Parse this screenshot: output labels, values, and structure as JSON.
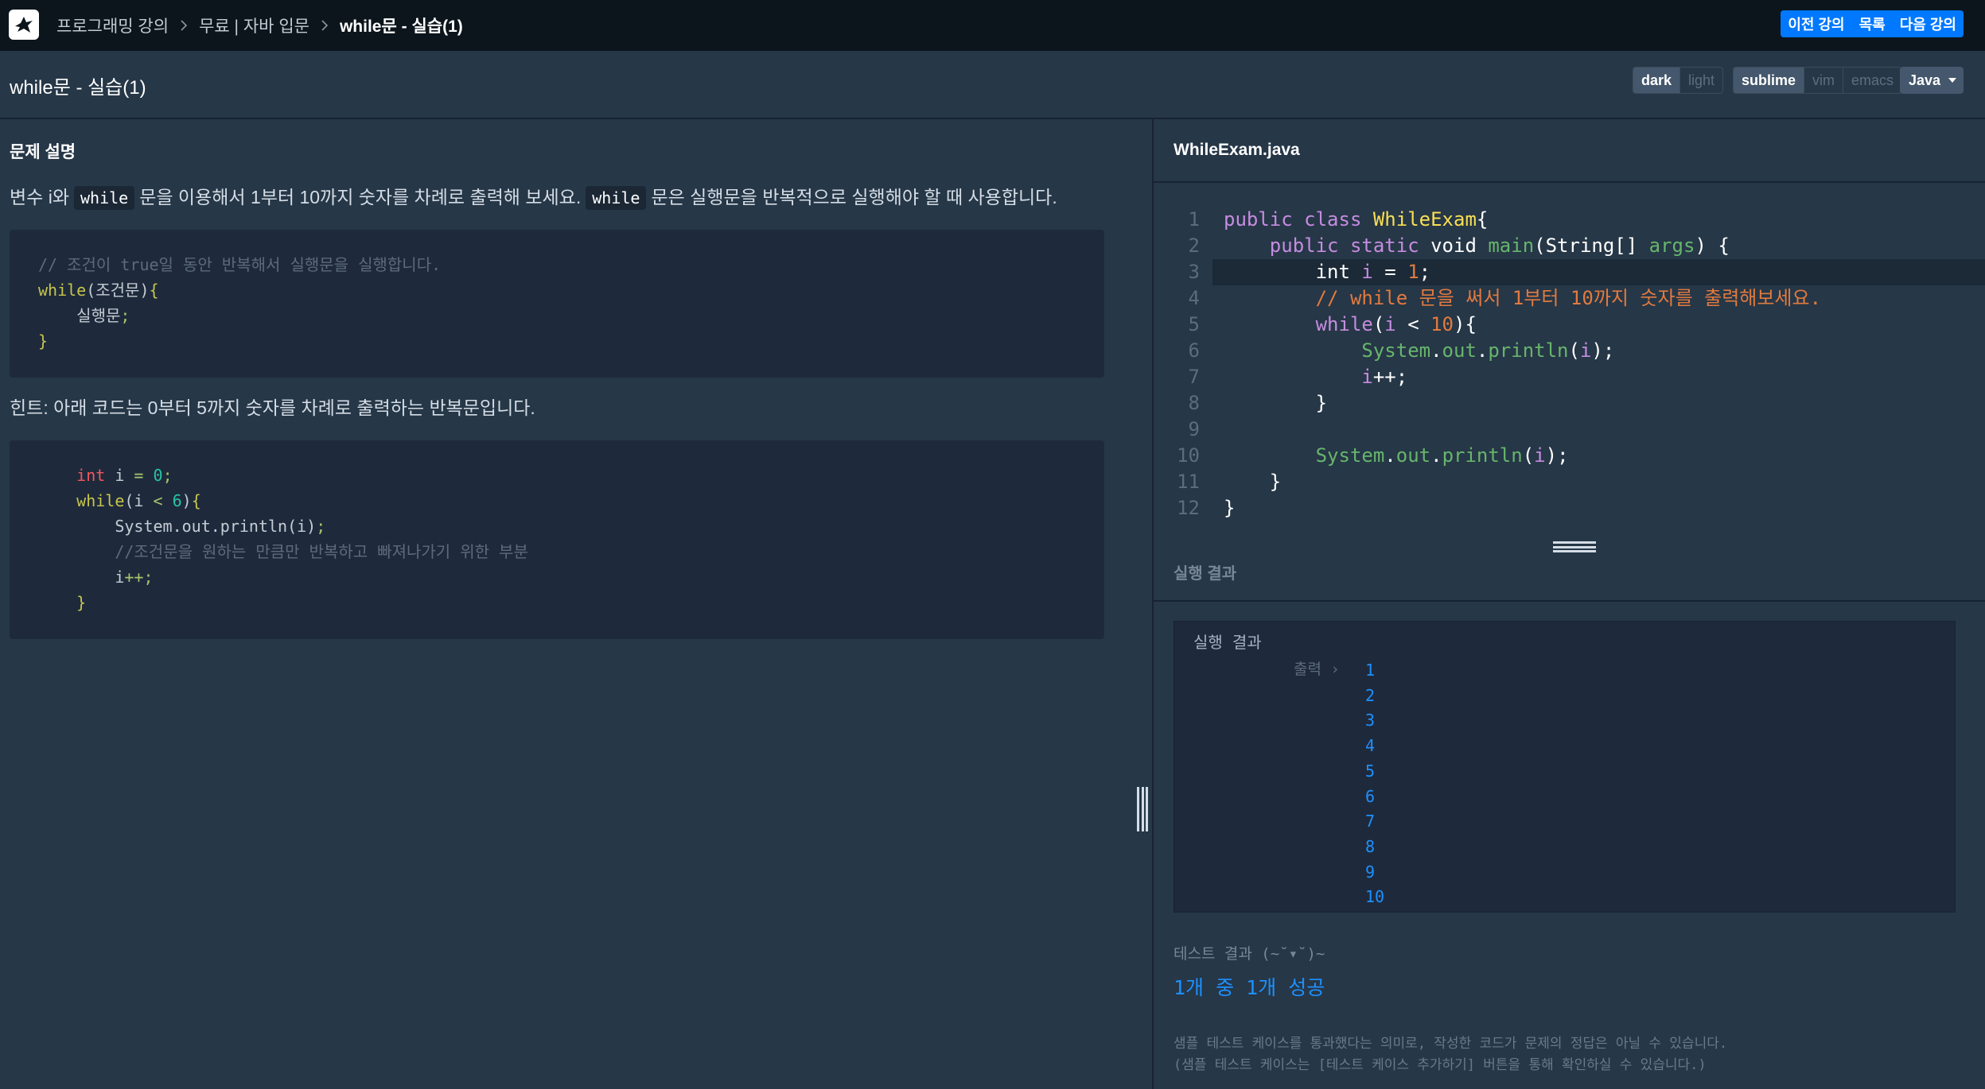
{
  "nav": {
    "breadcrumbs": [
      "프로그래밍 강의",
      "무료 | 자바 입문",
      "while문 - 실습(1)"
    ],
    "buttons": [
      "이전 강의",
      "목록",
      "다음 강의"
    ]
  },
  "titlebar": {
    "title": "while문 - 실습(1)",
    "theme_options": [
      "dark",
      "light"
    ],
    "theme_selected": "dark",
    "keymap_options": [
      "sublime",
      "vim",
      "emacs"
    ],
    "keymap_selected": "sublime",
    "language": "Java"
  },
  "problem": {
    "heading": "문제 설명",
    "desc_part1": "변수 i와",
    "desc_code1": "while",
    "desc_part2": "문을 이용해서 1부터 10까지 숫자를 차례로 출력해 보세요.",
    "desc_code2": "while",
    "desc_part3": "문은 실행문을 반복적으로 실행해야 할 때 사용합니다.",
    "hint": "힌트: 아래 코드는 0부터 5까지 숫자를 차례로 출력하는 반복문입니다."
  },
  "editor": {
    "file_name": "WhileExam.java",
    "line_numbers": [
      "1",
      "2",
      "3",
      "4",
      "5",
      "6",
      "7",
      "8",
      "9",
      "10",
      "11",
      "12"
    ]
  },
  "result": {
    "title": "실행 결과",
    "box_label": "실행 결과",
    "output_prefix": "출력 ›",
    "output": [
      "1",
      "2",
      "3",
      "4",
      "5",
      "6",
      "7",
      "8",
      "9",
      "10"
    ],
    "test_label": "테스트 결과 (~˘▾˘)~",
    "test_summary": "1개 중 1개 성공",
    "note_line1": "샘플 테스트 케이스를 통과했다는 의미로, 작성한 코드가 문제의 정답은 아닐 수 있습니다.",
    "note_line2": "(샘플 테스트 케이스는 [테스트 케이스 추가하기] 버튼을 통해 확인하실 수 있습니다.)"
  },
  "colors": {
    "background": "#263747",
    "topnav": "#0c151c",
    "accent": "#0078ff",
    "output": "#1e90ff"
  }
}
